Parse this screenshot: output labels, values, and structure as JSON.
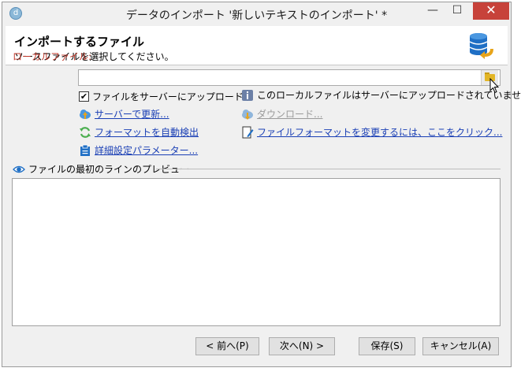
{
  "window": {
    "title": "データのインポート '新しいテキストのインポート' *",
    "app_icon_glyph": "d",
    "minimize_glyph": "—",
    "maximize_glyph": "☐",
    "close_glyph": "✕"
  },
  "header": {
    "title": "インポートするファイル",
    "subtitle": "ソースファイルを選択してください。",
    "icon": "database-import-icon"
  },
  "local_file": {
    "label": "ローカルファイル:",
    "value": "",
    "browse_icon": "folder-icon"
  },
  "options": {
    "upload_checkbox_label": "ファイルをサーバーにアップロード",
    "upload_checked": true,
    "check_glyph": "✔",
    "info_text": "このローカルファイルはサーバーにアップロードされていません",
    "update_on_server": "サーバーで更新...",
    "download": "ダウンロード...",
    "auto_detect_format": "フォーマットを自動検出",
    "change_format": "ファイルフォーマットを変更するには、ここをクリック...",
    "advanced_params": "詳細設定パラメーター..."
  },
  "preview": {
    "label": "ファイルの最初のラインのプレビュー",
    "content": ""
  },
  "buttons": {
    "prev": "< 前へ(P)",
    "next": "次へ(N) >",
    "save": "保存(S)",
    "cancel": "キャンセル(A)"
  },
  "colors": {
    "required_label": "#c0392b",
    "link": "#1a3fb5",
    "close_button": "#c7423a"
  }
}
